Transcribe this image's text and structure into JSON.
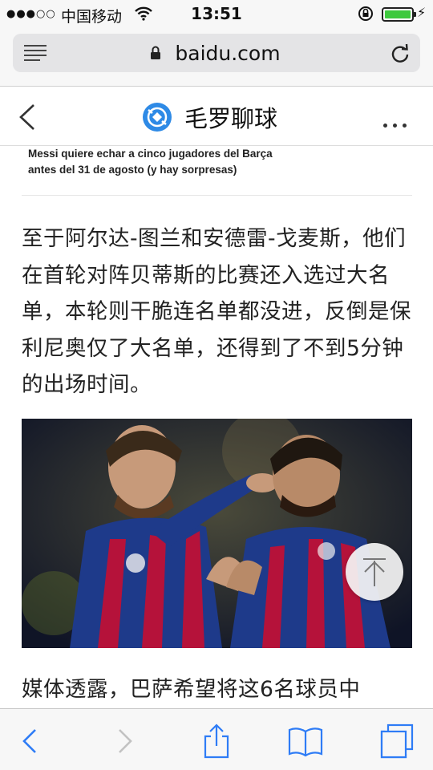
{
  "status_bar": {
    "signal": "●●●○○",
    "carrier": "中国移动",
    "time": "13:51"
  },
  "browser": {
    "url": "baidu.com"
  },
  "header": {
    "brand_name": "毛罗聊球"
  },
  "article": {
    "snippet_headline": "Messi quiere echar a cinco jugadores del Barça antes del 31 de agosto (y hay sorpresas)",
    "paragraph_1": "至于阿尔达-图兰和安德雷-戈麦斯，他们在首轮对阵贝蒂斯的比赛还入选过大名单，本轮则干脆连名单都没进，反倒是保利尼奥仅了大名单，还得到了不到5分钟的出场时间。",
    "paragraph_2": "媒体透露，巴萨希望将这6名球员中"
  },
  "icons": {
    "wifi": "wifi-icon",
    "lock": "lock-icon",
    "battery": "battery-icon",
    "menu": "menu-icon",
    "reload": "reload-icon",
    "back": "back-chevron-icon",
    "brand_logo": "brand-logo-icon",
    "more": "more-icon",
    "scroll_top": "scroll-to-top-icon",
    "toolbar": [
      "back-arrow-icon",
      "forward-arrow-icon",
      "share-icon",
      "bookmarks-icon",
      "tabs-icon"
    ]
  },
  "colors": {
    "accent": "#2e7cf6",
    "battery": "#3ec93e",
    "brand_logo": "#2e8ae6"
  }
}
